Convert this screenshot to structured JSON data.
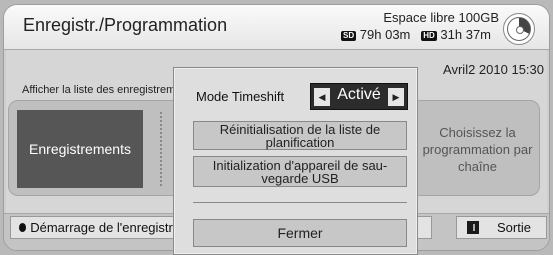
{
  "header": {
    "title": "Enregistr./Programmation",
    "free_space_label": "Espace libre 100GB",
    "sd_badge": "SD",
    "sd_time": "79h 03m",
    "hd_badge": "HD",
    "hd_time": "31h 37m",
    "disk_icon": "disk-usage-icon"
  },
  "main": {
    "list_label": "Afficher la liste des enregistrements",
    "datetime": "Avril2 2010 15:30",
    "recordings_button": "Enregistrements",
    "channel_schedule_button": "Choisissez la programmation par chaîne"
  },
  "footer": {
    "start_recording_button": "Démarrage de l'enregistrement",
    "exit_button": "Sortie",
    "exit_icon": "exit-icon",
    "record_icon": "record-dot-icon"
  },
  "modal": {
    "timeshift_label": "Mode Timeshift",
    "timeshift_value": "Activé",
    "reset_schedule_button": "Réinitialisation de la liste de planification",
    "usb_init_button": "Initialization d'appareil de sau-vegarde USB",
    "close_button": "Fermer"
  },
  "colors": {
    "selected": "#565656",
    "background": "#d6d6d6",
    "active_value_bg": "#2c2c2c"
  }
}
